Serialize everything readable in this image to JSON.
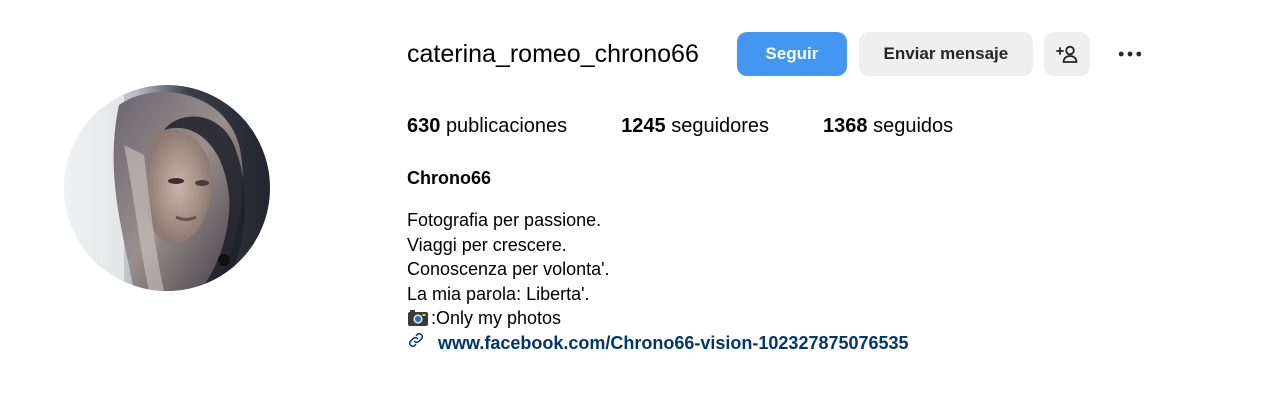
{
  "profile": {
    "username": "caterina_romeo_chrono66",
    "display_name": "Chrono66",
    "avatar_icon": "profile-photo"
  },
  "actions": {
    "follow_label": "Seguir",
    "message_label": "Enviar mensaje",
    "suggest_icon": "add-person-icon",
    "more_icon": "more-options-icon"
  },
  "stats": {
    "posts": {
      "count": "630",
      "label": "publicaciones"
    },
    "followers": {
      "count": "1245",
      "label": "seguidores"
    },
    "following": {
      "count": "1368",
      "label": "seguidos"
    }
  },
  "bio": {
    "lines": [
      "Fotografia per passione.",
      "Viaggi per crescere.",
      "Conoscenza per volonta'.",
      "La mia parola: Liberta'."
    ],
    "camera_line": ":Only my photos",
    "camera_icon": "camera-emoji",
    "link": "www.facebook.com/Chrono66-vision-102327875076535",
    "link_icon": "link-icon"
  },
  "colors": {
    "follow_button": "#4396f2",
    "secondary_button": "#efefef",
    "link": "#00376b"
  }
}
